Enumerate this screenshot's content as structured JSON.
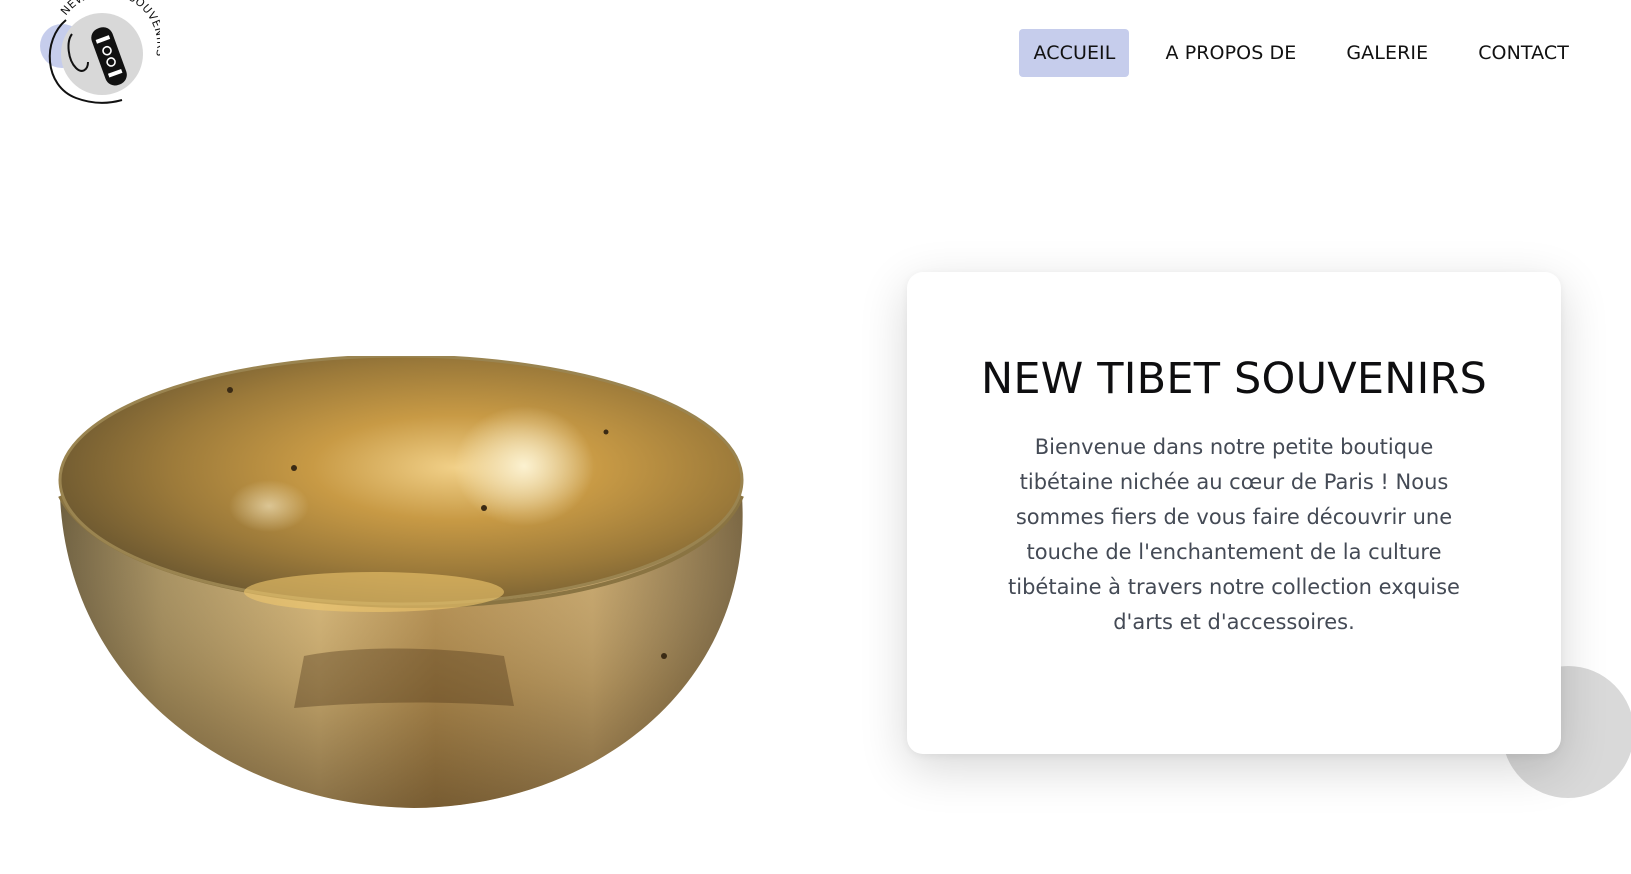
{
  "logo": {
    "text": "NEW TIBET SOUVENIRS",
    "icon": "singing-bowl-logo-icon",
    "accent": "#c6cdec"
  },
  "nav": {
    "items": [
      {
        "label": "ACCUEIL",
        "active": true
      },
      {
        "label": "A PROPOS DE",
        "active": false
      },
      {
        "label": "GALERIE",
        "active": false
      },
      {
        "label": "CONTACT",
        "active": false
      }
    ],
    "active_color": "#c6cdec"
  },
  "hero": {
    "image": "singing-bowl-image",
    "title": "NEW TIBET SOUVENIRS",
    "text": "Bienvenue dans notre petite boutique tibétaine nichée au cœur de Paris ! Nous sommes fiers de vous faire découvrir une touche de l'enchantement de la culture tibétaine à travers notre collection exquise d'arts et d'accessoires."
  },
  "colors": {
    "background": "#ffffff",
    "title": "#0e0e10",
    "body_text": "#444a55",
    "deco_circle": "#d9d9d9"
  }
}
